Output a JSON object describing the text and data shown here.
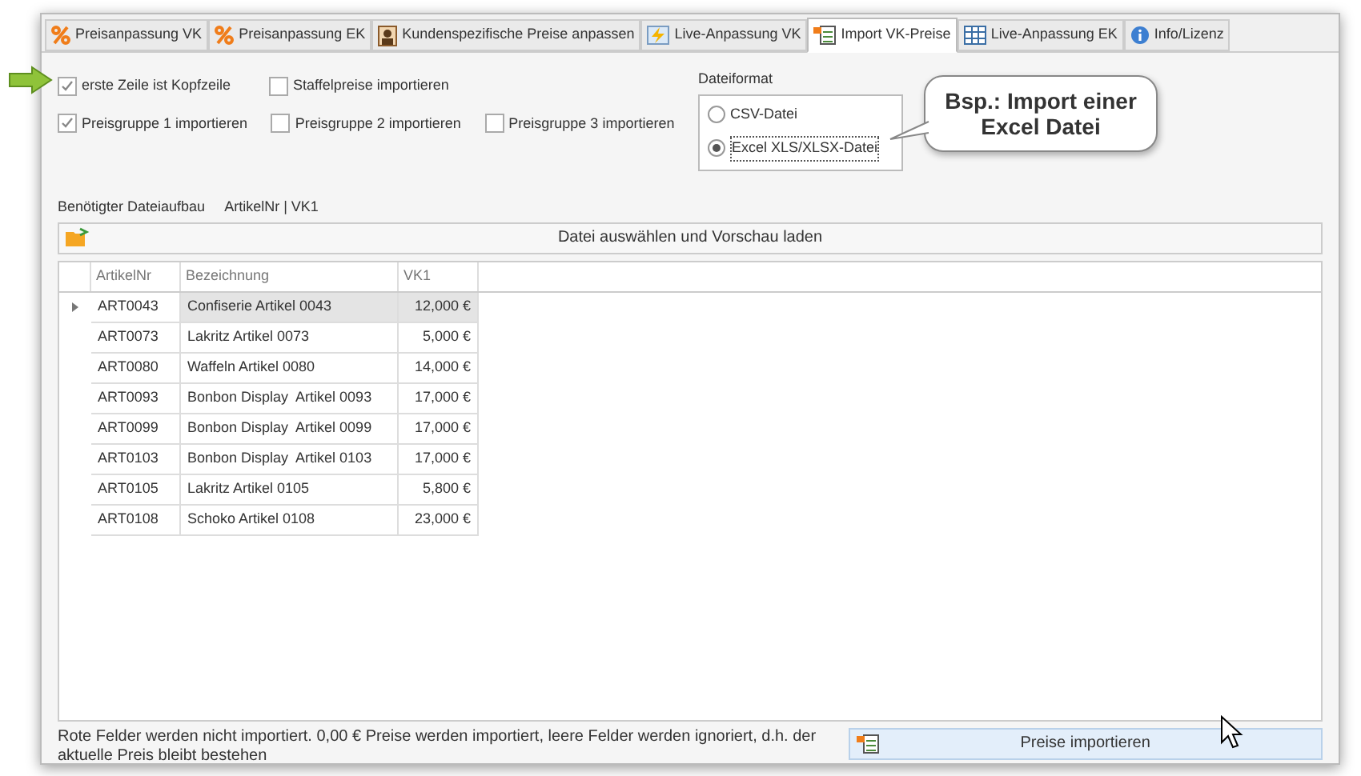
{
  "tabs": [
    {
      "label": "Preisanpassung VK",
      "kind": "percent",
      "selected": false
    },
    {
      "label": "Preisanpassung EK",
      "kind": "percent",
      "selected": false
    },
    {
      "label": "Kundenspezifische Preise anpassen",
      "kind": "person",
      "selected": false
    },
    {
      "label": "Live-Anpassung VK",
      "kind": "lightning",
      "selected": false
    },
    {
      "label": "Import VK-Preise",
      "kind": "import",
      "selected": true
    },
    {
      "label": "Live-Anpassung EK",
      "kind": "grid",
      "selected": false
    },
    {
      "label": "Info/Lizenz",
      "kind": "info",
      "selected": false
    }
  ],
  "options": [
    [
      {
        "label": "erste Zeile ist Kopfzeile",
        "checked": true
      },
      {
        "label": "Staffelpreise importieren",
        "checked": false
      }
    ],
    [
      {
        "label": "Preisgruppe 1 importieren",
        "checked": true
      },
      {
        "label": "Preisgruppe 2 importieren",
        "checked": false
      },
      {
        "label": "Preisgruppe 3 importieren",
        "checked": false
      }
    ]
  ],
  "file_format": {
    "title": "Dateiformat",
    "choices": [
      {
        "label": "CSV-Datei",
        "selected": false
      },
      {
        "label": "Excel XLS/XLSX-Datei",
        "selected": true
      }
    ]
  },
  "callout": "Bsp.: Import einer Excel Datei",
  "structure": {
    "label": "Benötigter Dateiaufbau",
    "value": "ArtikelNr | VK1"
  },
  "load_button": "Datei auswählen und Vorschau laden",
  "table": {
    "columns": [
      "ArtikelNr",
      "Bezeichnung",
      "VK1"
    ],
    "rows": [
      {
        "cells": [
          "ART0043",
          "Confiserie Artikel 0043",
          "12,000 €"
        ],
        "selected": true
      },
      {
        "cells": [
          "ART0073",
          "Lakritz Artikel 0073",
          "5,000 €"
        ],
        "selected": false
      },
      {
        "cells": [
          "ART0080",
          "Waffeln Artikel 0080",
          "14,000 €"
        ],
        "selected": false
      },
      {
        "cells": [
          "ART0093",
          "Bonbon Display  Artikel 0093",
          "17,000 €"
        ],
        "selected": false
      },
      {
        "cells": [
          "ART0099",
          "Bonbon Display  Artikel 0099",
          "17,000 €"
        ],
        "selected": false
      },
      {
        "cells": [
          "ART0103",
          "Bonbon Display  Artikel 0103",
          "17,000 €"
        ],
        "selected": false
      },
      {
        "cells": [
          "ART0105",
          "Lakritz Artikel 0105",
          "5,800 €"
        ],
        "selected": false
      },
      {
        "cells": [
          "ART0108",
          "Schoko Artikel 0108",
          "23,000 €"
        ],
        "selected": false
      }
    ]
  },
  "note": "Rote Felder werden nicht importiert. 0,00 € Preise werden importiert, leere Felder werden ignoriert, d.h. der aktuelle Preis bleibt bestehen",
  "import_button": "Preise importieren"
}
